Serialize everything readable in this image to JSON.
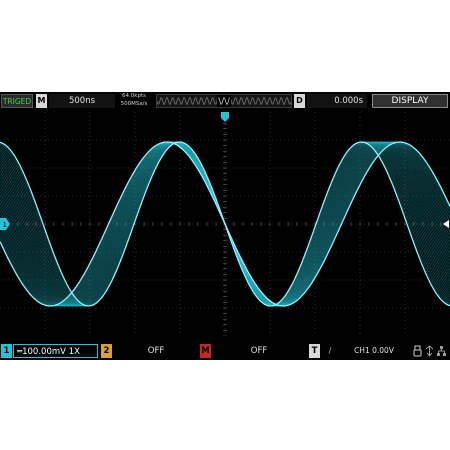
{
  "topbar": {
    "trigger_status": "TRIGED",
    "mode_badge": "M",
    "timebase": "500ns",
    "sampling_line1": "64.0kpts",
    "sampling_line2": "500MSa/s",
    "delay_badge": "D",
    "delay_value": "0.000s",
    "display_button": "DISPLAY"
  },
  "markers": {
    "ch1_marker_label": "1"
  },
  "bottombar": {
    "ch1_badge": "1",
    "ch1_setting": "═100.00mV  1X",
    "ch2_badge": "2",
    "ch2_status": "OFF",
    "math_badge": "M",
    "math_status": "OFF",
    "trigger_badge": "T",
    "trigger_slope": "∕",
    "trigger_info": "CH1 0.00V",
    "status_icons": [
      "usb-icon",
      "network-icon",
      "lan-icon"
    ]
  },
  "colors": {
    "ch1": "#24c4d6",
    "ch2": "#d9a032",
    "math": "#c62828",
    "trig_status": "#39d353",
    "background": "#000000",
    "grid": "#4a4a4a"
  }
}
